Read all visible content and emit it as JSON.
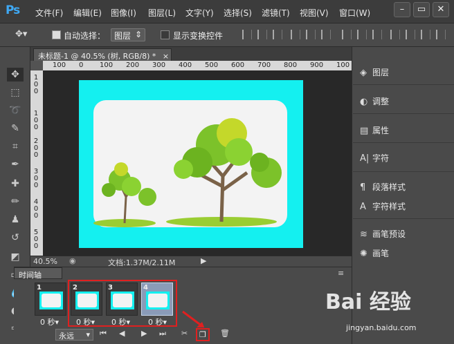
{
  "app": {
    "logo": "Ps"
  },
  "menu": [
    "文件(F)",
    "编辑(E)",
    "图像(I)",
    "图层(L)",
    "文字(Y)",
    "选择(S)",
    "滤镜(T)",
    "视图(V)",
    "窗口(W)"
  ],
  "options": {
    "auto_select_label": "自动选择：",
    "auto_select_value": "图层",
    "show_transform_label": "显示变换控件"
  },
  "document": {
    "tab_title": "未标题-1 @ 40.5% (树, RGB/8) *",
    "tab_close": "×"
  },
  "ruler": {
    "h_labels": [
      "100",
      "0",
      "100",
      "200",
      "300",
      "400",
      "500",
      "600",
      "700",
      "800",
      "900",
      "100"
    ],
    "v_labels": [
      "1\n0\n0",
      "1\n0\n0",
      "2\n0\n0",
      "3\n0\n0",
      "4\n0\n0",
      "5\n0\n0"
    ]
  },
  "status": {
    "zoom": "40.5%",
    "doc_info": "文档:1.37M/2.11M"
  },
  "timeline": {
    "tab": "时间轴",
    "frames": [
      {
        "num": "1",
        "delay": "0 秒▾",
        "active": false
      },
      {
        "num": "2",
        "delay": "0 秒▾",
        "active": false
      },
      {
        "num": "3",
        "delay": "0 秒▾",
        "active": false
      },
      {
        "num": "4",
        "delay": "0 秒▾",
        "active": true
      }
    ],
    "loop": "永远",
    "controls": [
      "⏮",
      "◀",
      "▶",
      "⏭"
    ]
  },
  "panels": [
    "图层",
    "调整",
    "属性",
    "字符",
    "段落样式",
    "字符样式",
    "画笔预设",
    "画笔"
  ],
  "watermark": {
    "brand": "Bai 经验",
    "url": "jingyan.baidu.com"
  },
  "colors": {
    "canvas_bg": "#14f0f0",
    "highlight": "#e02020"
  }
}
